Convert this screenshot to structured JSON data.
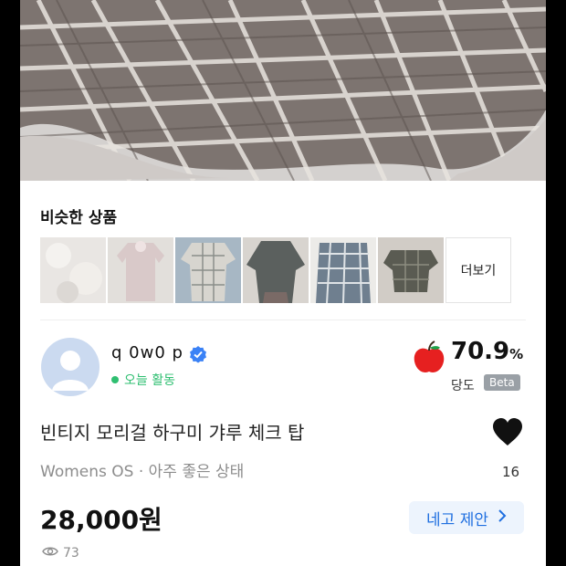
{
  "similar": {
    "title": "비슷한 상품",
    "more_label": "더보기"
  },
  "seller": {
    "name": "q 0w0 p",
    "status": "오늘 활동",
    "sweetness_score": "70.9",
    "sweetness_unit": "%",
    "sweetness_label": "당도",
    "beta_badge": "Beta"
  },
  "product": {
    "title": "빈티지 모리걸 하구미 갸루 체크 탑",
    "meta": "Womens OS · 아주 좋은 상태",
    "price": "28,000원",
    "likes": "16",
    "views": "73"
  },
  "actions": {
    "offer_label": "네고 제안"
  },
  "colors": {
    "accent": "#1f6fe0",
    "active": "#2fbf71",
    "offer_bg": "#edf4fd"
  }
}
